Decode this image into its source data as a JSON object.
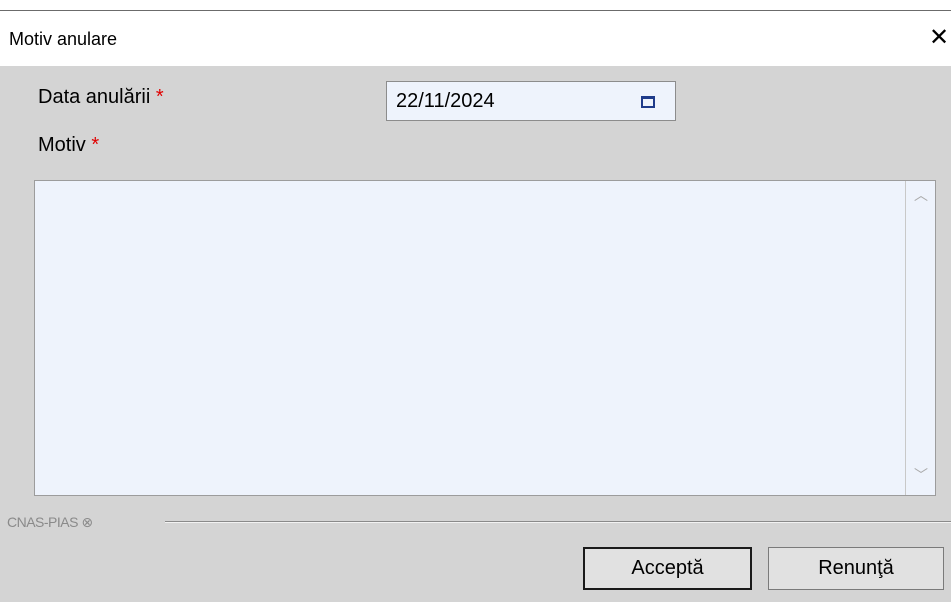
{
  "window": {
    "title": "Motiv anulare",
    "close_glyph": "✕"
  },
  "form": {
    "date_label": "Data anulării",
    "required_mark": "*",
    "date_value": "22/11/2024",
    "motiv_label": "Motiv",
    "motiv_value": ""
  },
  "footer": {
    "brand": "CNAS-PIAS",
    "brand_mark": "⊗",
    "accept_label": "Acceptă",
    "cancel_label": "Renunţă"
  },
  "icons": {
    "calendar": "calendar-icon",
    "close": "close-icon",
    "scroll_up": "scroll-up-arrow-icon",
    "scroll_down": "scroll-down-arrow-icon"
  }
}
